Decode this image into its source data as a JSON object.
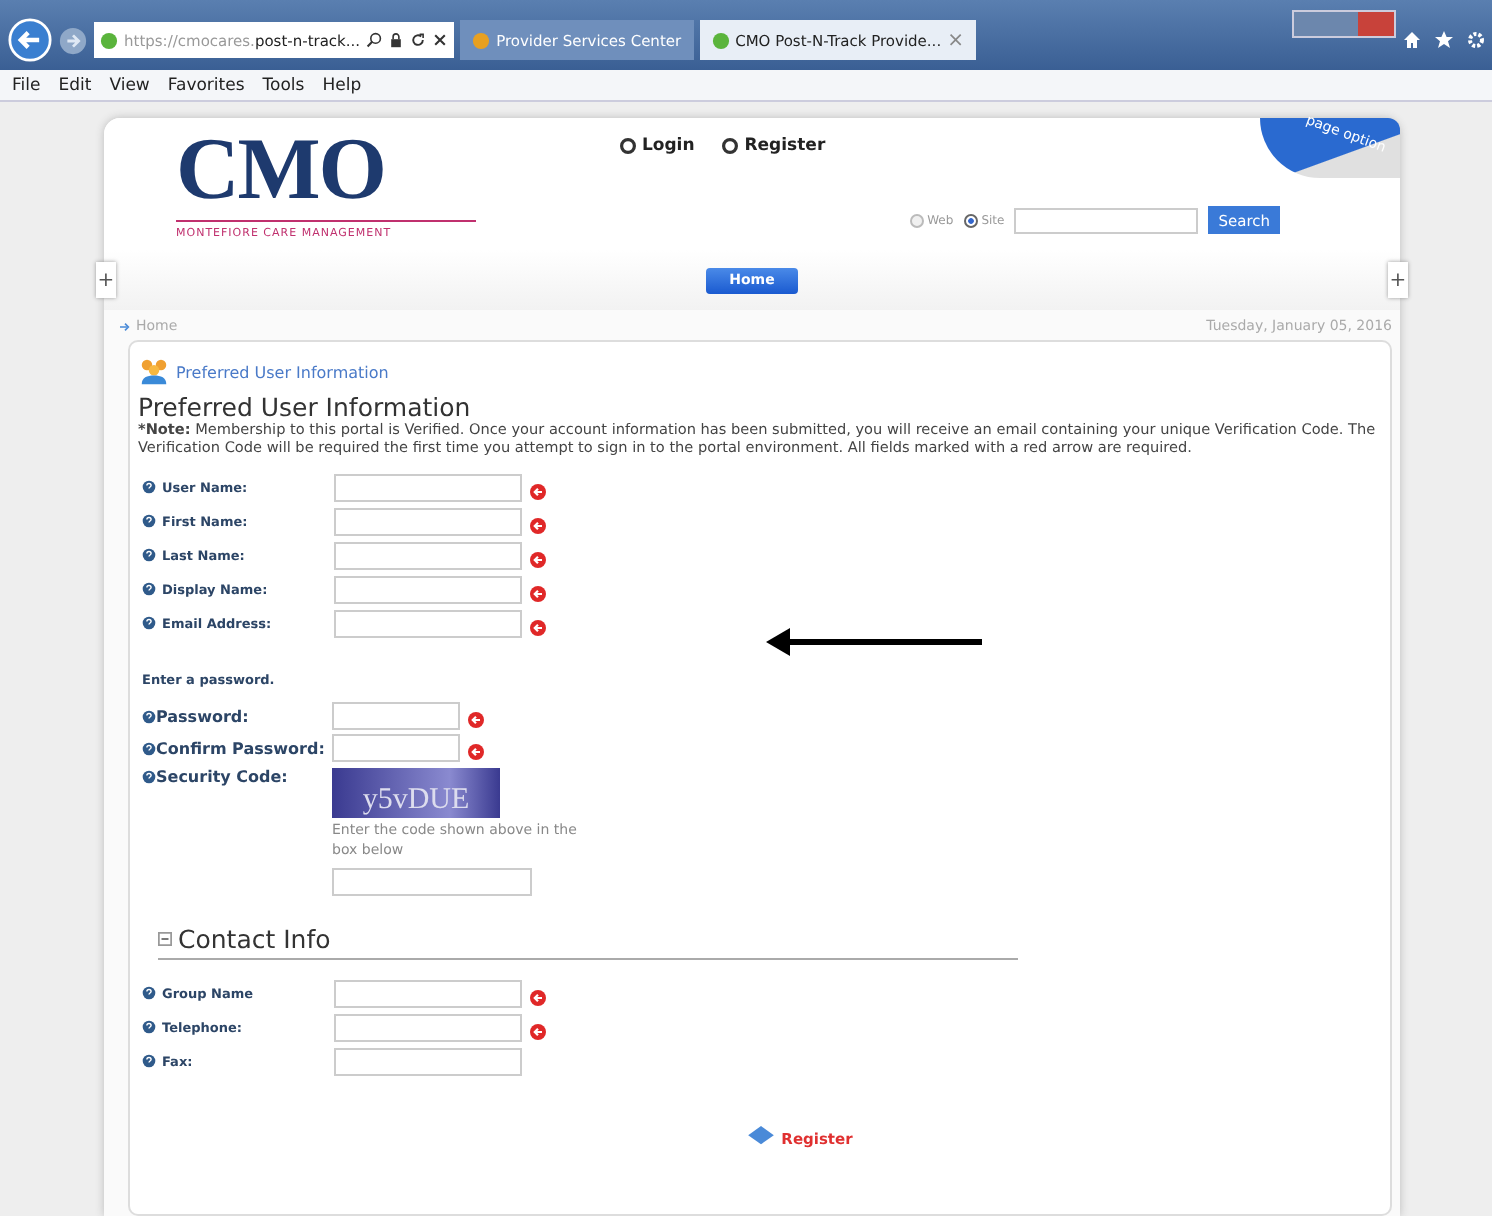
{
  "browser": {
    "url_faint": "https://cmocares.",
    "url_main": "post-n-track...",
    "tabs": [
      {
        "title": "Provider Services Center",
        "selected": false
      },
      {
        "title": "CMO Post-N-Track Provide...",
        "selected": true,
        "close": "×"
      }
    ],
    "menu": [
      "File",
      "Edit",
      "View",
      "Favorites",
      "Tools",
      "Help"
    ]
  },
  "header": {
    "logo": "CMO",
    "tagline": "MONTEFIORE CARE MANAGEMENT",
    "links": [
      "Login",
      "Register"
    ],
    "search_scope": [
      {
        "label": "Web",
        "selected": false
      },
      {
        "label": "Site",
        "selected": true
      }
    ],
    "search_button": "Search",
    "page_option": "page option",
    "nav": [
      {
        "label": "Home",
        "selected": true
      }
    ],
    "expand_buttons": [
      "+",
      "+"
    ]
  },
  "breadcrumb": "Home",
  "date": "Tuesday, January 05, 2016",
  "form": {
    "section_link": "Preferred User Information",
    "title": "Preferred User Information",
    "note_label": "*Note:",
    "note": "Membership to this portal is Verified. Once your account information has been submitted, you will receive an email containing your unique Verification Code. The Verification Code will be required the first time you attempt to sign in to the portal environment. All fields marked with a red arrow are required.",
    "fields": [
      {
        "label": "User Name:",
        "required": true
      },
      {
        "label": "First Name:",
        "required": true
      },
      {
        "label": "Last Name:",
        "required": true
      },
      {
        "label": "Display Name:",
        "required": true
      },
      {
        "label": "Email Address:",
        "required": true
      }
    ],
    "password_heading": "Enter a password.",
    "password_fields": [
      {
        "label": "Password:",
        "required": true
      },
      {
        "label": "Confirm Password:",
        "required": true
      }
    ],
    "security_label": "Security Code:",
    "captcha": "y5vDUE",
    "captcha_hint": "Enter the code shown above in the box below",
    "contact_title": "Contact Info",
    "contact_fields": [
      {
        "label": "Group Name",
        "required": true
      },
      {
        "label": "Telephone:",
        "required": true
      },
      {
        "label": "Fax:",
        "required": false
      }
    ],
    "register": "Register"
  }
}
